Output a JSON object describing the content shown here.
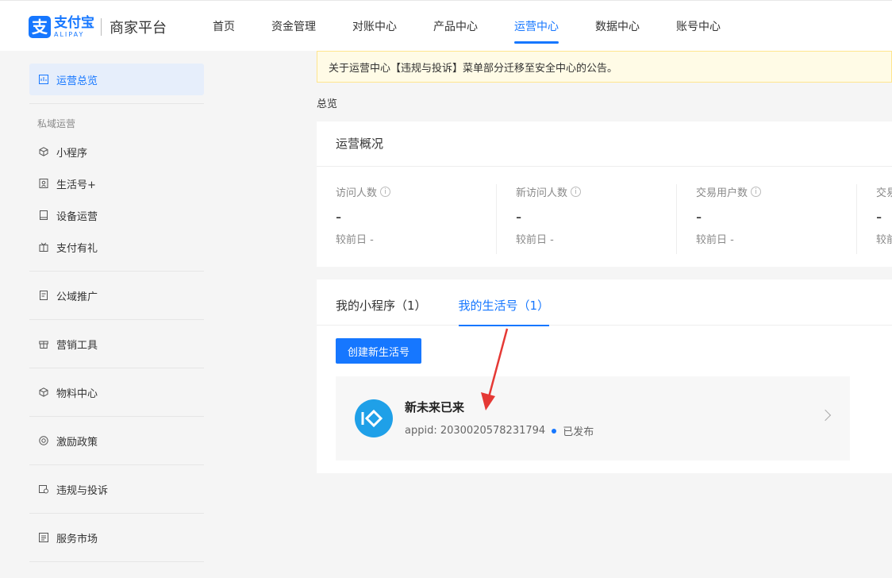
{
  "header": {
    "logo_cn": "支付宝",
    "logo_en": "ALIPAY",
    "platform": "商家平台",
    "nav": [
      {
        "label": "首页"
      },
      {
        "label": "资金管理"
      },
      {
        "label": "对账中心"
      },
      {
        "label": "产品中心"
      },
      {
        "label": "运营中心"
      },
      {
        "label": "数据中心"
      },
      {
        "label": "账号中心"
      }
    ],
    "active_nav": "运营中心"
  },
  "sidebar": {
    "active_item": "运营总览",
    "group_label": "私域运营",
    "group_items": [
      {
        "label": "小程序",
        "icon": "cube-icon"
      },
      {
        "label": "生活号+",
        "icon": "profile-icon"
      },
      {
        "label": "设备运营",
        "icon": "device-icon"
      },
      {
        "label": "支付有礼",
        "icon": "gift-icon"
      }
    ],
    "items": [
      {
        "label": "公域推广",
        "icon": "document-icon"
      },
      {
        "label": "营销工具",
        "icon": "gift-box-icon"
      },
      {
        "label": "物料中心",
        "icon": "cube-icon"
      },
      {
        "label": "激励政策",
        "icon": "badge-icon"
      },
      {
        "label": "违规与投诉",
        "icon": "complaint-icon"
      },
      {
        "label": "服务市场",
        "icon": "list-icon"
      }
    ]
  },
  "notice": "关于运营中心【违规与投诉】菜单部分迁移至安全中心的公告。",
  "breadcrumb": "总览",
  "overview": {
    "title": "运营概况",
    "stats": [
      {
        "label": "访问人数",
        "value": "-",
        "compare": "较前日 -"
      },
      {
        "label": "新访问人数",
        "value": "-",
        "compare": "较前日 -"
      },
      {
        "label": "交易用户数",
        "value": "-",
        "compare": "较前日 -"
      },
      {
        "label": "交易",
        "value": "-",
        "compare": "较前"
      }
    ]
  },
  "apps": {
    "tabs": [
      {
        "label": "我的小程序（1）"
      },
      {
        "label": "我的生活号（1）"
      }
    ],
    "active_tab": "我的生活号（1）",
    "create_button": "创建新生活号",
    "item": {
      "name": "新未来已来",
      "appid": "appid: 2030020578231794",
      "status": "已发布"
    }
  },
  "colors": {
    "accent": "#1677ff",
    "notice_bg": "#fffbe6",
    "avatar_bg": "#1fa0e8",
    "arrow": "#e53935"
  }
}
